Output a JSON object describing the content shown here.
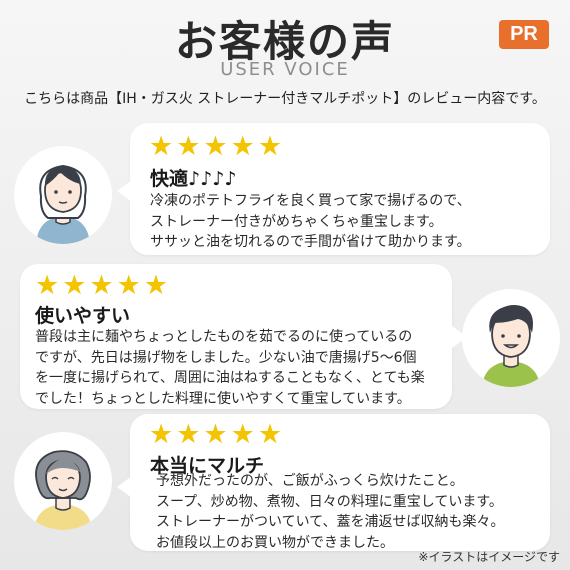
{
  "header": {
    "title": "お客様の声",
    "subtitle": "USER VOICE",
    "badge": "PR",
    "intro": "こちらは商品【IH・ガス火 ストレーナー付きマルチポット】のレビュー内容です。"
  },
  "reviews": [
    {
      "stars": "★★★★★",
      "heading": "快適♪♪♪♪",
      "lines": [
        "冷凍のポテトフライを良く買って家で揚げるので、",
        "ストレーナー付きがめちゃくちゃ重宝します。",
        "ササッと油を切れるので手間が省けて助かります。"
      ],
      "avatar_icon": "woman-avatar-icon"
    },
    {
      "stars": "★★★★★",
      "heading": "使いやすい",
      "lines": [
        "普段は主に麺やちょっとしたものを茹でるのに使っているの",
        "ですが、先日は揚げ物をしました。少ない油で唐揚げ5～6個",
        "を一度に揚げられて、周囲に油はねすることもなく、とても楽",
        "でした！ちょっとした料理に使いやすくて重宝しています。"
      ],
      "avatar_icon": "man-avatar-icon"
    },
    {
      "stars": "★★★★★",
      "heading": "本当にマルチ",
      "lines": [
        "予想外だったのが、ご飯がふっくら炊けたこと。",
        "スープ、炒め物、煮物、日々の料理に重宝しています。",
        "ストレーナーがついていて、蓋を浦返せば収納も楽々。",
        "お値段以上のお買い物ができました。"
      ],
      "avatar_icon": "older-woman-avatar-icon"
    }
  ],
  "footer": {
    "note": "※イラストはイメージです"
  },
  "colors": {
    "badge": "#e86f2c",
    "star": "#f3c400",
    "hair": "#3a3f47",
    "shirt_woman": "#8fb5cf",
    "shirt_man": "#9bc24a",
    "shirt_older": "#f2dc8a"
  }
}
